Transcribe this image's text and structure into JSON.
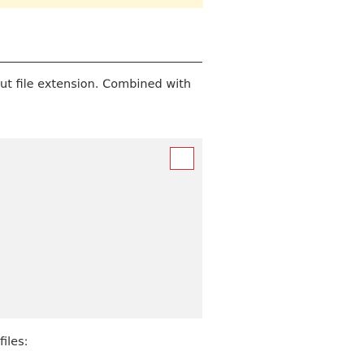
{
  "article": {
    "paragraph_fragment": "ut file extension. Combined with",
    "trailing_fragment": "files:"
  },
  "colors": {
    "note_background": "#fff8d8",
    "code_background": "#f2f2f2",
    "focus_outline": "#c4313b",
    "text": "#323130"
  }
}
